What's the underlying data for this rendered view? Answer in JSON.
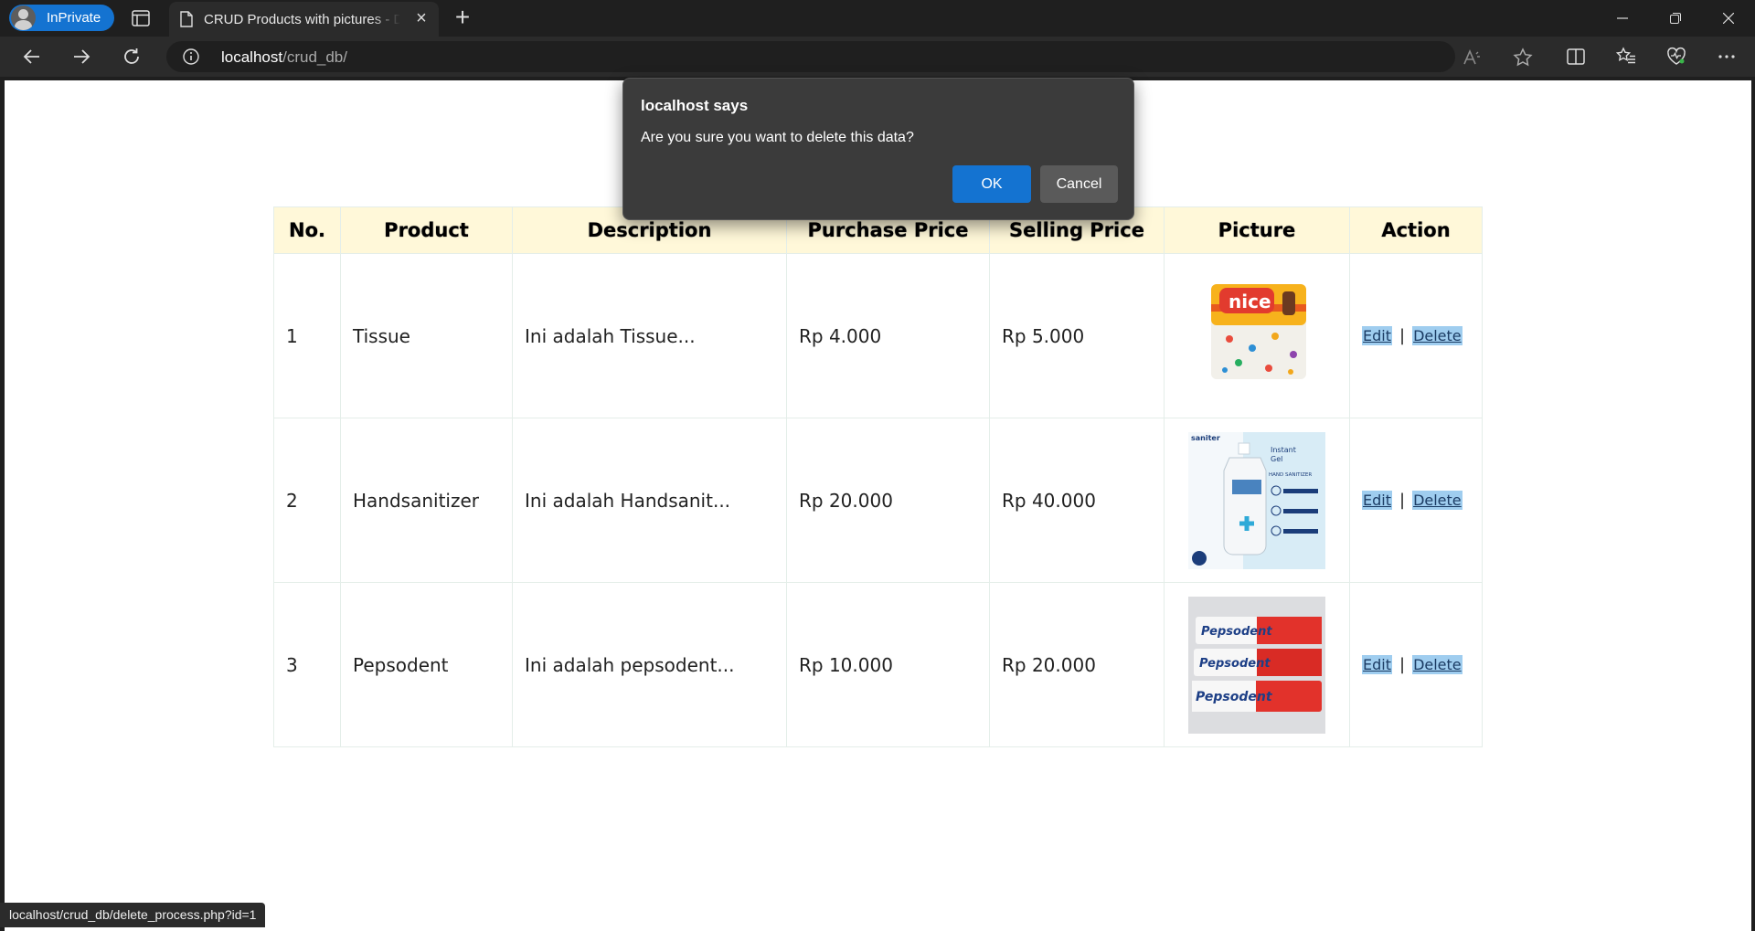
{
  "browser": {
    "inprivate_label": "InPrivate",
    "tab_title": "CRUD Products with pictures - Data",
    "url_host": "localhost",
    "url_path": "/crud_db/",
    "status_url": "localhost/crud_db/delete_process.php?id=1"
  },
  "table": {
    "headers": [
      "No.",
      "Product",
      "Description",
      "Purchase Price",
      "Selling Price",
      "Picture",
      "Action"
    ],
    "rows": [
      {
        "no": "1",
        "product": "Tissue",
        "description": "Ini adalah Tissue...",
        "purchase": "Rp 4.000",
        "selling": "Rp 5.000",
        "picture": "tissue-box-image"
      },
      {
        "no": "2",
        "product": "Handsanitizer",
        "description": "Ini adalah Handsanit...",
        "purchase": "Rp 20.000",
        "selling": "Rp 40.000",
        "picture": "hand-sanitizer-image"
      },
      {
        "no": "3",
        "product": "Pepsodent",
        "description": "Ini adalah pepsodent...",
        "purchase": "Rp 10.000",
        "selling": "Rp 20.000",
        "picture": "toothpaste-image"
      }
    ],
    "edit_label": "Edit",
    "delete_label": "Delete",
    "separator": "|"
  },
  "image_text": {
    "tissue_brand": "nice",
    "sanitizer_brand": "saniter",
    "sanitizer_instant": "Instant",
    "sanitizer_gel": "Gel",
    "sanitizer_label": "HAND SANITIZER",
    "toothpaste_brand": "Pepsodent"
  },
  "dialog": {
    "title": "localhost says",
    "message": "Are you sure you want to delete this data?",
    "ok_label": "OK",
    "cancel_label": "Cancel"
  },
  "colors": {
    "header_bg": "#fff8d9",
    "accent": "#1473d1",
    "link_highlight": "#9fcdef"
  }
}
